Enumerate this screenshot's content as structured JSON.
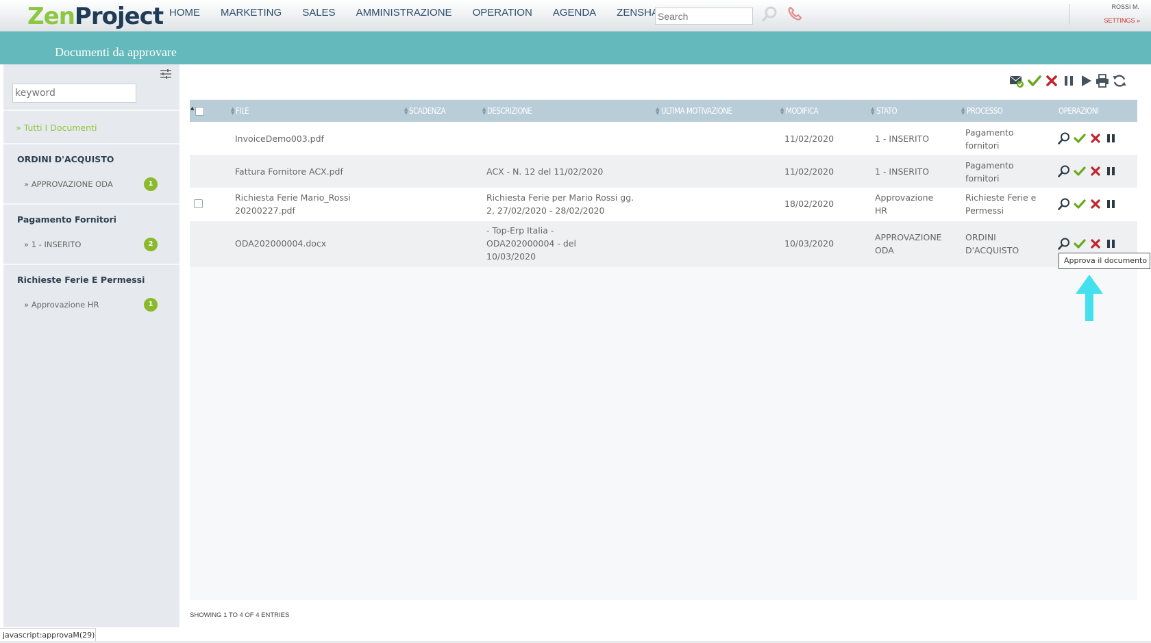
{
  "app": {
    "logo_part1": "Zen",
    "logo_part2": "Project",
    "nav": [
      "HOME",
      "MARKETING",
      "SALES",
      "AMMINISTRAZIONE",
      "OPERATION",
      "AGENDA",
      "ZENSHARE"
    ],
    "search_placeholder": "Search",
    "user": "ROSSI M.",
    "settings_label": "SETTINGS »"
  },
  "page_title": "Documenti da approvare",
  "sidebar": {
    "keyword_placeholder": "keyword",
    "all_docs": "» Tutti I Documenti",
    "groups": [
      {
        "title": "ORDINI D'ACQUISTO",
        "item": "» APPROVAZIONE ODA",
        "count": "1"
      },
      {
        "title": "Pagamento Fornitori",
        "item": "» 1 - INSERITO",
        "count": "2"
      },
      {
        "title": "Richieste Ferie E Permessi",
        "item": "» Approvazione HR",
        "count": "1"
      }
    ]
  },
  "table": {
    "columns": [
      "FILE",
      "SCADENZA",
      "DESCRIZIONE",
      "ULTIMA MOTIVAZIONE",
      "MODIFICA",
      "STATO",
      "PROCESSO",
      "OPERAZIONI"
    ],
    "rows": [
      {
        "file": [
          "InvoiceDemo003.pdf"
        ],
        "scadenza": "",
        "descrizione": [],
        "motivazione": "",
        "modifica": "11/02/2020",
        "stato": [
          "1 - INSERITO"
        ],
        "processo": [
          "Pagamento",
          "fornitori"
        ]
      },
      {
        "file": [
          "Fattura Fornitore ACX.pdf"
        ],
        "scadenza": "",
        "descrizione": [
          "ACX - N. 12 del 11/02/2020"
        ],
        "motivazione": "",
        "modifica": "11/02/2020",
        "stato": [
          "1 - INSERITO"
        ],
        "processo": [
          "Pagamento",
          "fornitori"
        ]
      },
      {
        "file": [
          "Richiesta Ferie Mario_Rossi",
          "20200227.pdf"
        ],
        "scadenza": "",
        "descrizione": [
          "Richiesta Ferie per Mario Rossi gg.",
          "2, 27/02/2020 - 28/02/2020"
        ],
        "motivazione": "",
        "modifica": "18/02/2020",
        "stato": [
          "Approvazione",
          "HR"
        ],
        "processo": [
          "Richieste Ferie e",
          "Permessi"
        ]
      },
      {
        "file": [
          "ODA202000004.docx"
        ],
        "scadenza": "",
        "descrizione": [
          "- Top-Erp Italia -",
          "ODA202000004 - del",
          "10/03/2020"
        ],
        "motivazione": "",
        "modifica": "10/03/2020",
        "stato": [
          "APPROVAZIONE",
          "ODA"
        ],
        "processo": [
          "ORDINI",
          "D'ACQUISTO"
        ]
      }
    ]
  },
  "tooltip": "Approva il documento",
  "footer_info": "SHOWING 1 TO 4 OF 4 ENTRIES",
  "status_bar": "javascript:approvaM(29)",
  "colors": {
    "accent_teal": "#63b9bc",
    "brand_green": "#8dc63f",
    "approve": "#6aa81e",
    "reject": "#c0262c",
    "nav_text": "#2a4d6a"
  }
}
